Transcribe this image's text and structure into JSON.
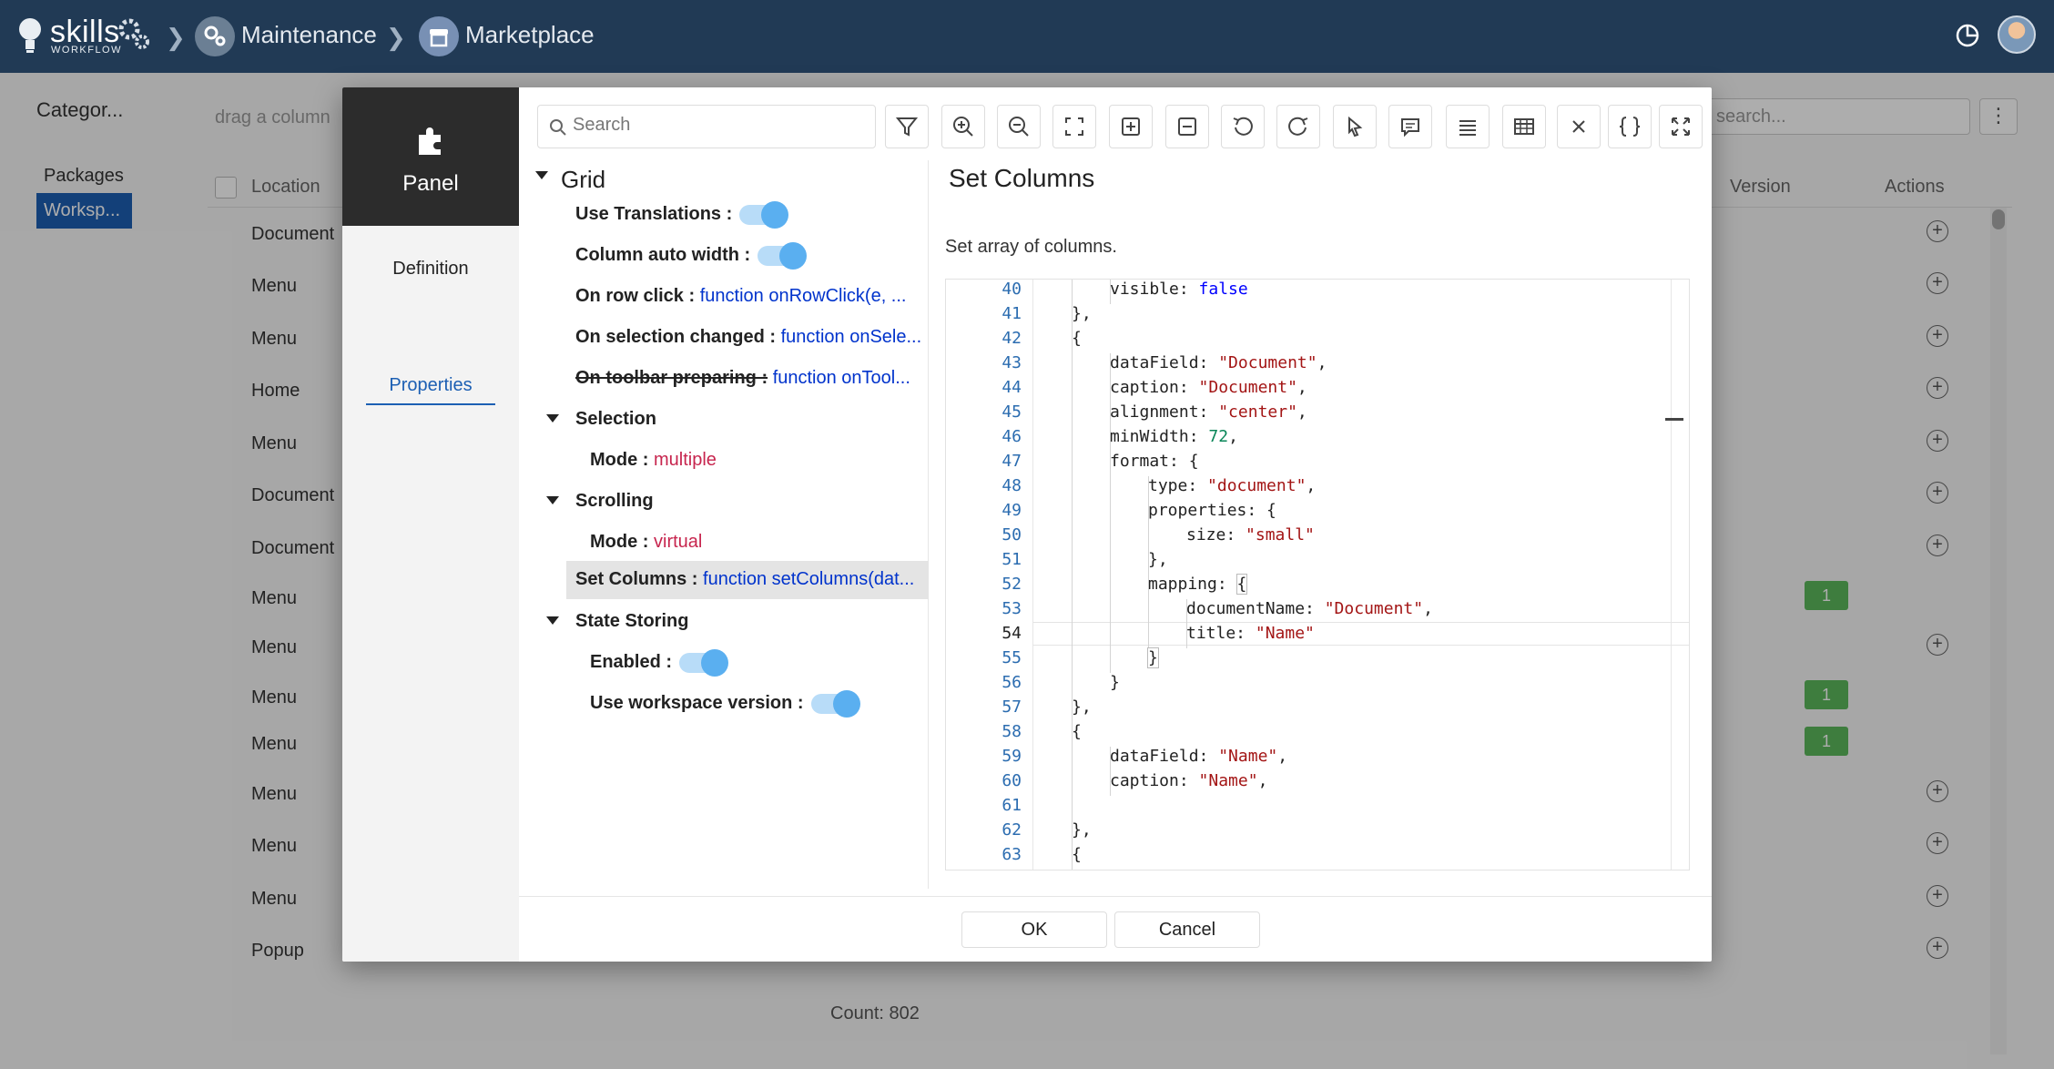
{
  "topbar": {
    "logo_text": "skills",
    "logo_sub": "WORKFLOW",
    "crumbs": [
      "Maintenance",
      "Marketplace"
    ]
  },
  "background": {
    "category_title": "Categor...",
    "categories": [
      "Packages",
      "Worksp..."
    ],
    "drag_hint": "drag a column",
    "search_placeholder": "search...",
    "columns": {
      "location": "Location",
      "version": "Version",
      "actions": "Actions"
    },
    "rows": [
      "Document",
      "Menu",
      "Menu",
      "Home",
      "Menu",
      "Document",
      "Document",
      "Menu",
      "Menu",
      "Menu",
      "Menu",
      "Menu",
      "Menu",
      "Menu",
      "Popup"
    ],
    "version_badge": "1",
    "count": "Count: 802"
  },
  "modal": {
    "side": {
      "panel": "Panel",
      "definition": "Definition",
      "properties": "Properties"
    },
    "search_placeholder": "Search",
    "tree": {
      "root": "Grid",
      "use_translations": "Use Translations :",
      "column_auto_width": "Column auto width :",
      "on_row_click_k": "On row click :",
      "on_row_click_v": "function onRowClick(e, ...",
      "on_selection_changed_k": "On selection changed :",
      "on_selection_changed_v": "function onSele...",
      "on_toolbar_preparing_k": "On toolbar preparing :",
      "on_toolbar_preparing_v": "function onTool...",
      "selection": "Selection",
      "selection_mode_k": "Mode :",
      "selection_mode_v": "multiple",
      "scrolling": "Scrolling",
      "scrolling_mode_k": "Mode :",
      "scrolling_mode_v": "virtual",
      "set_columns_k": "Set Columns :",
      "set_columns_v": "function setColumns(dat...",
      "state_storing": "State Storing",
      "enabled": "Enabled :",
      "use_workspace_version": "Use workspace version :"
    },
    "editor": {
      "title": "Set Columns",
      "description": "Set array of columns."
    },
    "footer": {
      "ok": "OK",
      "cancel": "Cancel"
    }
  }
}
